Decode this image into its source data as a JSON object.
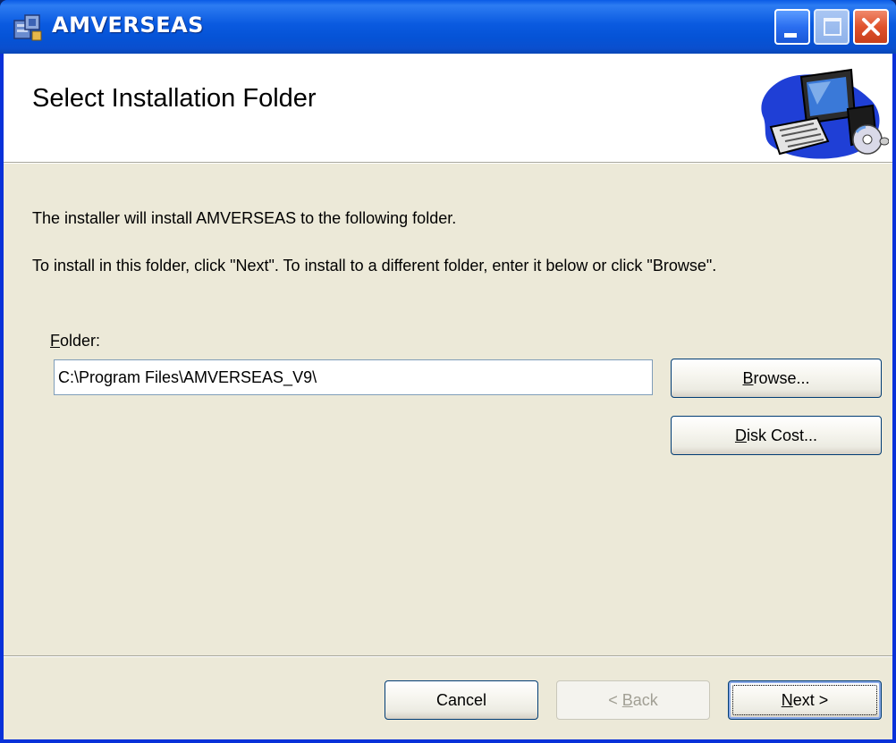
{
  "window": {
    "title": "AMVERSEAS",
    "minimize_icon": "minimize-icon",
    "maximize_icon": "maximize-icon",
    "close_icon": "close-icon"
  },
  "banner": {
    "title": "Select Installation Folder",
    "image_icon": "computer-cd-icon"
  },
  "content": {
    "intro_line1": "The installer will install AMVERSEAS to the following folder.",
    "intro_line2": "To install in this folder, click \"Next\". To install to a different folder, enter it below or click \"Browse\".",
    "folder_label_accel": "F",
    "folder_label_rest": "older:",
    "folder_value": "C:\\Program Files\\AMVERSEAS_V9\\"
  },
  "buttons": {
    "browse_accel": "B",
    "browse_rest": "rowse...",
    "diskcost_accel": "D",
    "diskcost_rest": "isk Cost...",
    "cancel": "Cancel",
    "back_prefix": "< ",
    "back_accel": "B",
    "back_rest": "ack",
    "next_accel": "N",
    "next_rest": "ext >"
  },
  "colors": {
    "titlebar": "#0a5ae0",
    "client_bg": "#ece9d8",
    "close_button": "#e0522c"
  }
}
